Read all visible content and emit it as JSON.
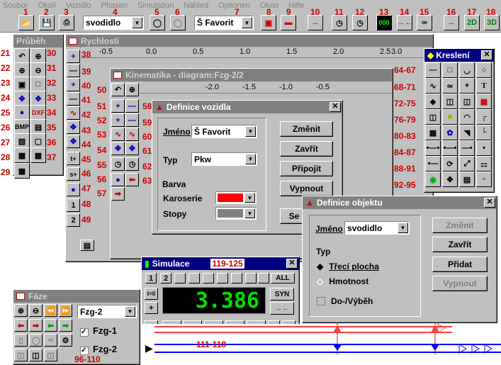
{
  "menu": [
    "Soubor",
    "Okolí",
    "Vozidlo",
    "Phasen",
    "Simulation",
    "Náhled",
    "Optionen",
    "Okno",
    "Hilfe"
  ],
  "toolbar": {
    "combo1": "svodidlo",
    "combo2": "Š Favorit"
  },
  "toolbar_nums": [
    "1",
    "2",
    "3",
    "4",
    "5",
    "6",
    "7",
    "8",
    "9",
    "10",
    "11",
    "12",
    "13",
    "14",
    "15",
    "16",
    "17",
    "18"
  ],
  "btn2d": "2D",
  "btn3d": "3D",
  "prubeh": {
    "title": "Průběh",
    "labels": [
      "BMP",
      "DXF"
    ],
    "nums_left": [
      "21",
      "22",
      "23",
      "24",
      "25",
      "26",
      "27",
      "28",
      "29"
    ],
    "nums_right": [
      "30",
      "31",
      "32",
      "33",
      "34",
      "35",
      "36",
      "37"
    ]
  },
  "rychlosti": {
    "title": "Rychlosti",
    "ticks": [
      "-0.5",
      "0.0",
      "0.5",
      "1.0",
      "1.5",
      "2.0",
      "2.5",
      "3.0"
    ],
    "nums": [
      "38",
      "39",
      "40",
      "41",
      "42",
      "43",
      "44",
      "45",
      "46",
      "47",
      "48",
      "49"
    ],
    "side_btns": [
      "1",
      "2"
    ],
    "small_btns": [
      "t+",
      "s+"
    ]
  },
  "kinematika": {
    "title": "Kinematika - diagram:Fzg-2/2",
    "ticks": [
      "-2.0",
      "-1.5",
      "-1.0",
      "-0.5"
    ],
    "nums_a": [
      "50",
      "51",
      "52",
      "53",
      "54",
      "55",
      "56",
      "57"
    ],
    "nums_b": [
      "58",
      "59",
      "60",
      "61",
      "62",
      "63"
    ]
  },
  "kresleni": {
    "title": "Kreslení",
    "nums": [
      "64-67",
      "68-71",
      "72-75",
      "76-79",
      "80-83",
      "84-87",
      "88-91",
      "92-95"
    ]
  },
  "vozidlo": {
    "title": "Definice vozidla",
    "jmeno_label": "Jméno",
    "jmeno_value": "Š Favorit",
    "typ_label": "Typ",
    "typ_value": "Pkw",
    "barva": "Barva",
    "karoserie": "Karoserie",
    "stopy": "Stopy",
    "buttons": [
      "Změnit",
      "Zavřít",
      "Připojit",
      "Vypnout"
    ],
    "se": "Se",
    "karoserie_color": "#ff0000",
    "stopy_color": "#808080"
  },
  "objekt": {
    "title": "Definice objektu",
    "jmeno_label": "Jméno",
    "jmeno_value": "svodidlo",
    "typ": "Typ",
    "radio1": "Třecí plocha",
    "radio2": "Hmotnost",
    "check": "Do-/Výběh",
    "buttons": [
      "Změnit",
      "Zavřít",
      "Přidat",
      "Vypnout"
    ]
  },
  "simulace": {
    "title": "Simulace",
    "range": "119-125",
    "tabs": [
      "1",
      "2"
    ],
    "all": "ALL",
    "syn": "SYN",
    "t0": "t=0",
    "display": "3.386",
    "nums": "111-118"
  },
  "faze": {
    "title": "Fáze",
    "combo": "Fzg-2",
    "items": [
      "Fzg-1",
      "Fzg-2"
    ],
    "nums": "96-110"
  }
}
